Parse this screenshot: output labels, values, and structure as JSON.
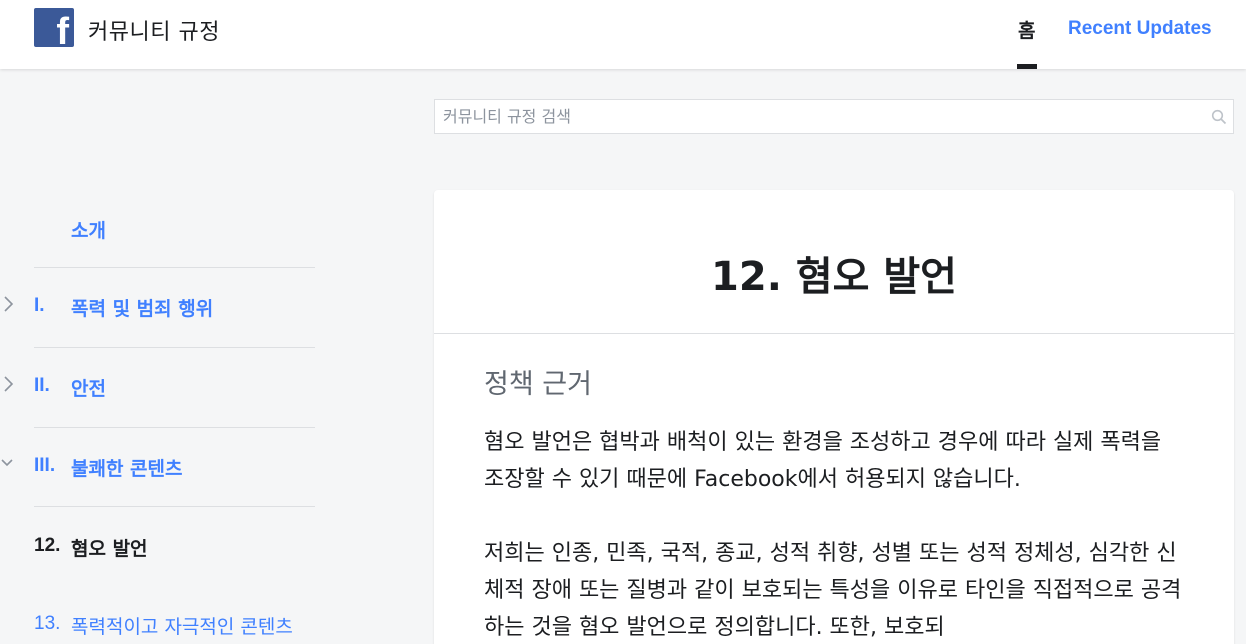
{
  "header": {
    "logo_letter": "f",
    "site_title": "커뮤니티 규정",
    "nav": {
      "home": "홈",
      "recent_updates": "Recent Updates"
    }
  },
  "search": {
    "placeholder": "커뮤니티 규정 검색"
  },
  "sidebar": {
    "items": [
      {
        "num": "",
        "label": "소개",
        "chevron": "none"
      },
      {
        "num": "I.",
        "label": "폭력 및 범죄 행위",
        "chevron": "right"
      },
      {
        "num": "II.",
        "label": "안전",
        "chevron": "right"
      },
      {
        "num": "III.",
        "label": "불쾌한 콘텐츠",
        "chevron": "down"
      },
      {
        "num": "12.",
        "label": "혐오 발언",
        "active": true
      },
      {
        "num": "13.",
        "label": "폭력적이고 자극적인 콘텐츠"
      }
    ]
  },
  "article": {
    "title": "12. 혐오 발언",
    "section_title": "정책 근거",
    "paragraphs": [
      "혐오 발언은 협박과 배척이 있는 환경을 조성하고 경우에 따라 실제 폭력을 조장할 수 있기 때문에 Facebook에서 허용되지 않습니다.",
      "저희는 인종, 민족, 국적, 종교, 성적 취향, 성별 또는 성적 정체성, 심각한 신체적 장애 또는 질병과 같이 보호되는 특성을 이유로 타인을 직접적으로 공격하는 것을 혐오 발언으로 정의합니다. 또한, 보호되"
    ]
  },
  "colors": {
    "brand": "#3b5998",
    "link": "#4080ff",
    "text": "#1c1e21",
    "muted": "#606770"
  }
}
